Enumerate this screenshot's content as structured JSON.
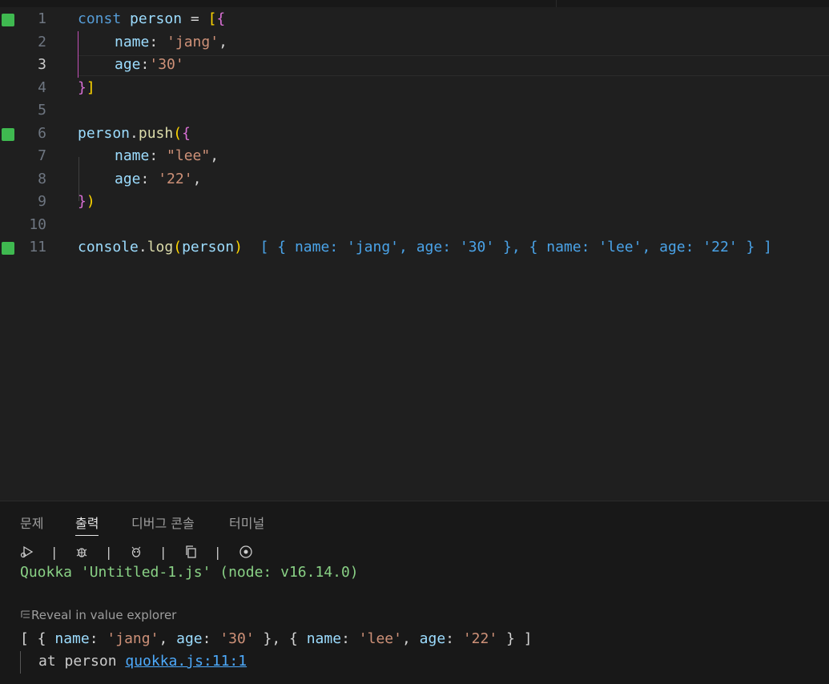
{
  "editor": {
    "lines": [
      {
        "n": "1",
        "marker": true
      },
      {
        "n": "2",
        "marker": false
      },
      {
        "n": "3",
        "marker": false,
        "active": true
      },
      {
        "n": "4",
        "marker": false
      },
      {
        "n": "5",
        "marker": false
      },
      {
        "n": "6",
        "marker": true
      },
      {
        "n": "7",
        "marker": false
      },
      {
        "n": "8",
        "marker": false
      },
      {
        "n": "9",
        "marker": false
      },
      {
        "n": "10",
        "marker": false
      },
      {
        "n": "11",
        "marker": true
      }
    ],
    "code": {
      "l1_kw": "const",
      "l1_var": "person",
      "l1_eq": " = ",
      "l1_b1": "[",
      "l1_b2": "{",
      "l2_key": "name",
      "l2_colon": ": ",
      "l2_str": "'jang'",
      "l2_comma": ",",
      "l3_key": "age",
      "l3_colon": ":",
      "l3_str": "'30'",
      "l4_b2": "}",
      "l4_b1": "]",
      "l6_var": "person",
      "l6_dot": ".",
      "l6_fn": "push",
      "l6_paren": "(",
      "l6_brace": "{",
      "l7_key": "name",
      "l7_colon": ": ",
      "l7_str": "\"lee\"",
      "l7_comma": ",",
      "l8_key": "age",
      "l8_colon": ": ",
      "l8_str": "'22'",
      "l8_comma": ",",
      "l9_brace": "}",
      "l9_paren": ")",
      "l11_var": "console",
      "l11_dot": ".",
      "l11_fn": "log",
      "l11_open": "(",
      "l11_arg": "person",
      "l11_close": ")",
      "l11_inline": "[ { name: 'jang', age: '30' }, { name: 'lee', age: '22' } ]"
    }
  },
  "panel": {
    "tabs": [
      "문제",
      "출력",
      "디버그 콘솔",
      "터미널"
    ],
    "active_tab": "출력",
    "toolbar_icons": [
      "run-icon",
      "debug-icon",
      "bug-icon",
      "copy-icon",
      "record-icon"
    ],
    "separator": "|",
    "quokka_line": "Quokka 'Untitled-1.js' (node: v16.14.0)",
    "reveal_label": "Reveal in value explorer",
    "result": {
      "open": "[ { ",
      "k1": "name",
      "c1": ": ",
      "v1": "'jang'",
      "s1": ", ",
      "k2": "age",
      "c2": ": ",
      "v2": "'30'",
      "mid": " }, { ",
      "k3": "name",
      "c3": ": ",
      "v3": "'lee'",
      "s3": ", ",
      "k4": "age",
      "c4": ": ",
      "v4": "'22'",
      "close": " } ]"
    },
    "at_prefix": "at person ",
    "at_link": "quokka.js:11:1"
  },
  "colors": {
    "marker": "#3fb950",
    "quokka": "#89d185",
    "inline_output": "#4aa3e8",
    "link": "#4daafc"
  }
}
